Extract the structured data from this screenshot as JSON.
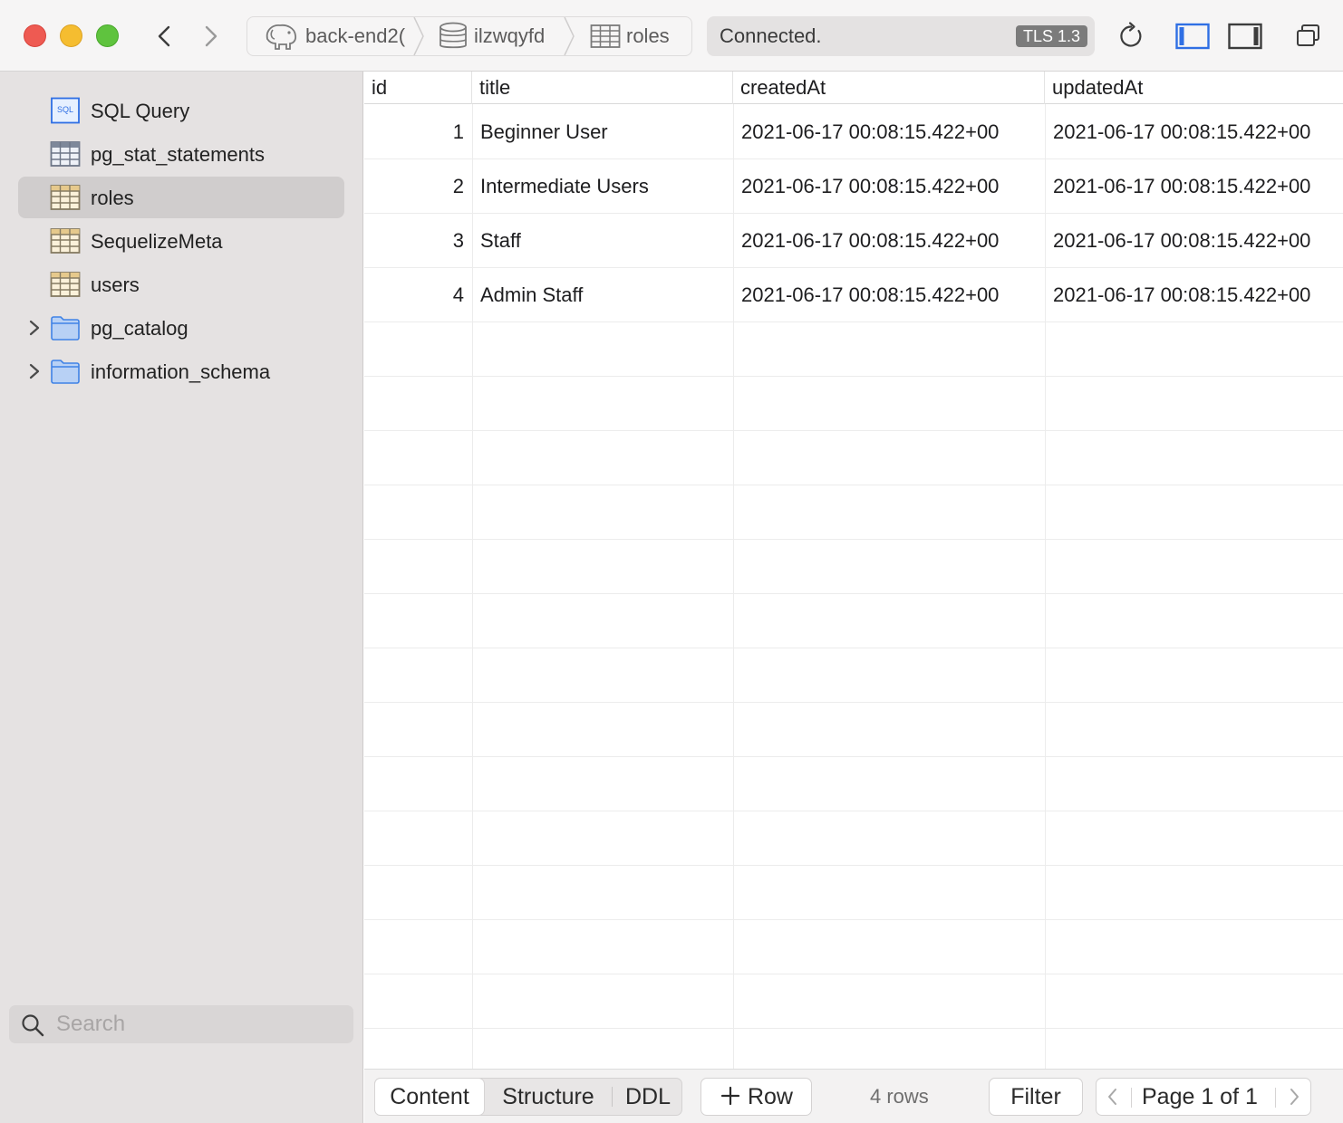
{
  "window": {
    "breadcrumb": {
      "connection": "back-end2(",
      "database": "ilzwqyfd",
      "table": "roles"
    },
    "status": {
      "text": "Connected.",
      "badge": "TLS 1.3"
    }
  },
  "sidebar": {
    "items": [
      {
        "label": "SQL Query",
        "icon": "sql-query-icon"
      },
      {
        "label": "pg_stat_statements",
        "icon": "view-icon"
      },
      {
        "label": "roles",
        "icon": "table-icon",
        "selected": true
      },
      {
        "label": "SequelizeMeta",
        "icon": "table-icon"
      },
      {
        "label": "users",
        "icon": "table-icon"
      },
      {
        "label": "pg_catalog",
        "icon": "folder-icon",
        "expandable": true
      },
      {
        "label": "information_schema",
        "icon": "folder-icon",
        "expandable": true
      }
    ],
    "search_placeholder": "Search"
  },
  "table": {
    "columns": [
      "id",
      "title",
      "createdAt",
      "updatedAt"
    ],
    "rows": [
      [
        "1",
        "Beginner User",
        "2021-06-17 00:08:15.422+00",
        "2021-06-17 00:08:15.422+00"
      ],
      [
        "2",
        "Intermediate Users",
        "2021-06-17 00:08:15.422+00",
        "2021-06-17 00:08:15.422+00"
      ],
      [
        "3",
        "Staff",
        "2021-06-17 00:08:15.422+00",
        "2021-06-17 00:08:15.422+00"
      ],
      [
        "4",
        "Admin Staff",
        "2021-06-17 00:08:15.422+00",
        "2021-06-17 00:08:15.422+00"
      ]
    ]
  },
  "footer": {
    "tabs": [
      "Content",
      "Structure",
      "DDL"
    ],
    "active_tab": "Content",
    "add_row_label": "Row",
    "rows_count": "4 rows",
    "filter_label": "Filter",
    "page_label": "Page 1 of 1"
  },
  "colors": {
    "accent": "#2f6fe4",
    "selection": "#d0cdcd",
    "sidebar_bg": "#e5e2e2"
  }
}
